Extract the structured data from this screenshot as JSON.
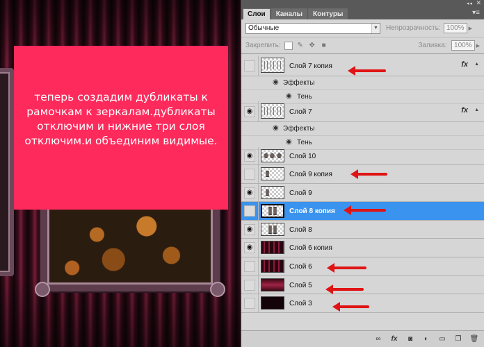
{
  "note": {
    "text": "теперь создадим дубликаты к рамочкам к зеркалам.дубликаты отключим и нижние три слоя отключим.и объединим видимые."
  },
  "panel": {
    "tabs": [
      "Слои",
      "Каналы",
      "Контуры"
    ],
    "blend_mode": "Обычные",
    "opacity_label": "Непрозрачность:",
    "opacity_value": "100%",
    "lock_label": "Закрепить:",
    "fill_label": "Заливка:",
    "fill_value": "100%",
    "fx_glyph": "fx",
    "effects_label": "Эффекты",
    "shadow_label": "Тень"
  },
  "layers": [
    {
      "name": "Слой 7 копия",
      "visible": false,
      "fx": true,
      "selected": false
    },
    {
      "name": "Слой 7",
      "visible": true,
      "fx": true,
      "selected": false
    },
    {
      "name": "Слой 10",
      "visible": true,
      "fx": false,
      "selected": false
    },
    {
      "name": "Слой 9 копия",
      "visible": false,
      "fx": false,
      "selected": false
    },
    {
      "name": "Слой 9",
      "visible": true,
      "fx": false,
      "selected": false
    },
    {
      "name": "Слой 8 копия",
      "visible": false,
      "fx": false,
      "selected": true
    },
    {
      "name": "Слой 8",
      "visible": true,
      "fx": false,
      "selected": false
    },
    {
      "name": "Слой 6 копия",
      "visible": true,
      "fx": false,
      "selected": false
    },
    {
      "name": "Слой 6",
      "visible": false,
      "fx": false,
      "selected": false
    },
    {
      "name": "Слой 5",
      "visible": false,
      "fx": false,
      "selected": false
    },
    {
      "name": "Слой 3",
      "visible": false,
      "fx": false,
      "selected": false
    }
  ],
  "colors": {
    "note_bg": "#fe2a5c",
    "selected_row": "#3a93ee",
    "annotation_arrow": "#e01414"
  }
}
